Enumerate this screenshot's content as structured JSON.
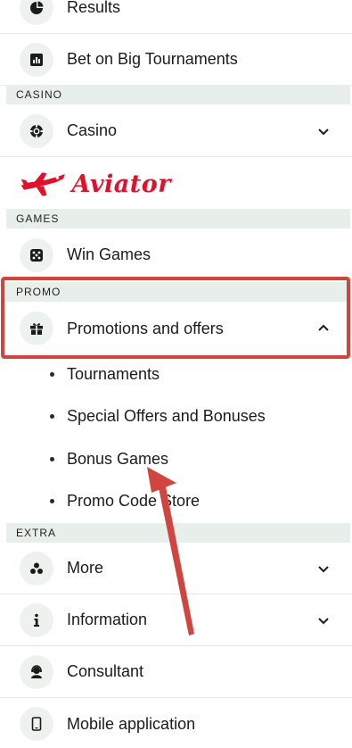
{
  "menu": {
    "results": {
      "label": "Results",
      "icon": "pie-chart-icon"
    },
    "big_tournaments": {
      "label": "Bet on Big Tournaments",
      "icon": "bar-chart-icon"
    },
    "casino_section": "CASINO",
    "casino": {
      "label": "Casino",
      "icon": "casino-chip-icon"
    },
    "aviator": {
      "label": "Aviator",
      "icon": "plane-icon"
    },
    "games_section": "GAMES",
    "win_games": {
      "label": "Win Games",
      "icon": "dice-icon"
    },
    "promo_section": "PROMO",
    "promotions": {
      "label": "Promotions and offers",
      "icon": "gift-icon",
      "expanded": true,
      "subitems": [
        "Tournaments",
        "Special Offers and Bonuses",
        "Bonus Games",
        "Promo Code Store"
      ]
    },
    "extra_section": "EXTRA",
    "more": {
      "label": "More",
      "icon": "dots-icon"
    },
    "information": {
      "label": "Information",
      "icon": "info-icon"
    },
    "consultant": {
      "label": "Consultant",
      "icon": "headset-icon"
    },
    "mobile": {
      "label": "Mobile application",
      "icon": "phone-icon"
    }
  },
  "colors": {
    "highlight_border": "#d1453f",
    "arrow": "#d1453f",
    "section_bg": "#e8efea",
    "icon_circle": "#eef2ef",
    "aviator_red": "#e3102c"
  }
}
